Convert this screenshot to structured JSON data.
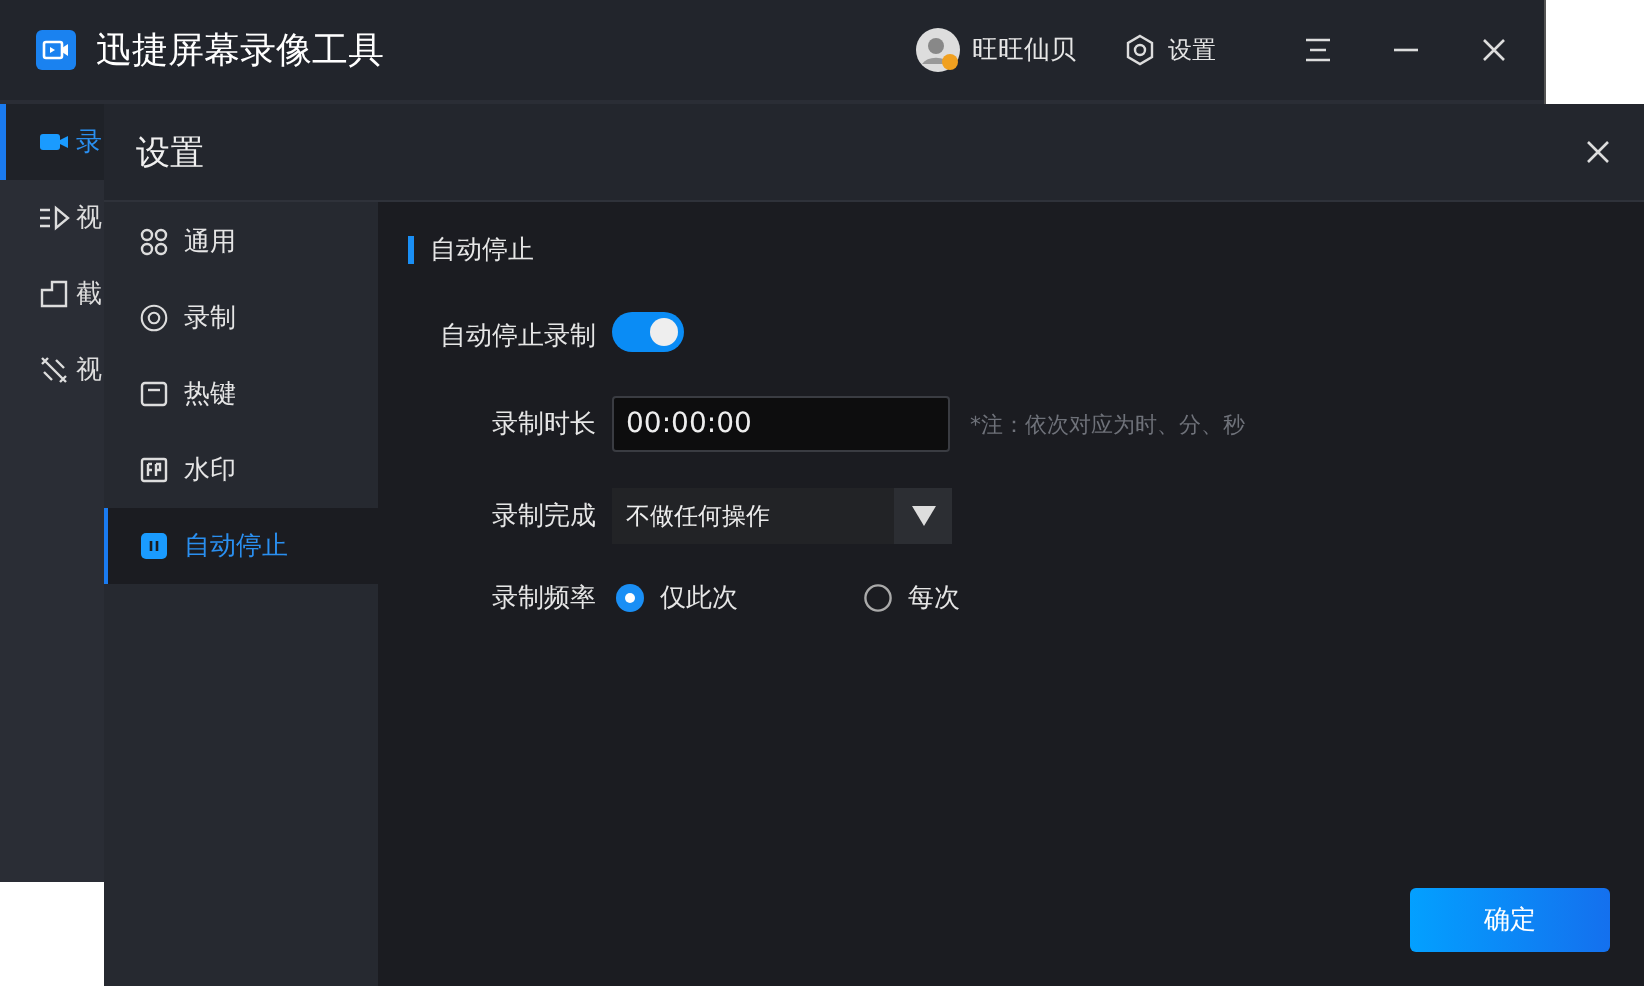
{
  "app": {
    "title": "迅捷屏幕录像工具",
    "user": "旺旺仙贝",
    "settings_label": "设置",
    "sidebar": [
      {
        "kind": "camera",
        "label": "录",
        "selected": true
      },
      {
        "kind": "play",
        "label": "视",
        "selected": false
      },
      {
        "kind": "crop",
        "label": "截",
        "selected": false
      },
      {
        "kind": "tools",
        "label": "视",
        "selected": false
      }
    ]
  },
  "dialog": {
    "title": "设置",
    "nav": [
      {
        "kind": "general",
        "label": "通用",
        "selected": false
      },
      {
        "kind": "record",
        "label": "录制",
        "selected": false
      },
      {
        "kind": "hotkey",
        "label": "热键",
        "selected": false
      },
      {
        "kind": "watermark",
        "label": "水印",
        "selected": false
      },
      {
        "kind": "autostop",
        "label": "自动停止",
        "selected": true
      }
    ],
    "section_title": "自动停止",
    "auto_stop": {
      "label": "自动停止录制",
      "on": true
    },
    "duration": {
      "label": "录制时长",
      "value": "00:00:00",
      "note": "*注：依次对应为时、分、秒"
    },
    "on_complete": {
      "label": "录制完成",
      "value": "不做任何操作"
    },
    "frequency": {
      "label": "录制频率",
      "options": [
        {
          "label": "仅此次",
          "selected": true
        },
        {
          "label": "每次",
          "selected": false
        }
      ]
    },
    "confirm": "确定"
  }
}
